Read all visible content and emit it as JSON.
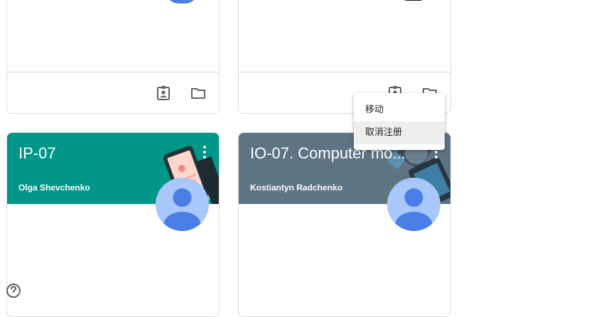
{
  "classes": [
    {
      "title": "IP-07",
      "teacher": "Olga Shevchenko",
      "header_color": "#009688"
    },
    {
      "title": "IO-07. Computer mo...",
      "teacher": "Kostiantyn Radchenko",
      "header_color": "#5f7482"
    }
  ],
  "context_menu": {
    "items": [
      {
        "label": "移动"
      },
      {
        "label": "取消注册"
      }
    ]
  },
  "icons": {
    "portfolio": "assignment-ind-icon",
    "folder": "folder-icon",
    "more": "more-vert-icon",
    "help": "help-icon"
  },
  "colors": {
    "border": "#dadce0",
    "avatar_bg": "#a8c7fa",
    "avatar_fg": "#4a7ee6"
  }
}
